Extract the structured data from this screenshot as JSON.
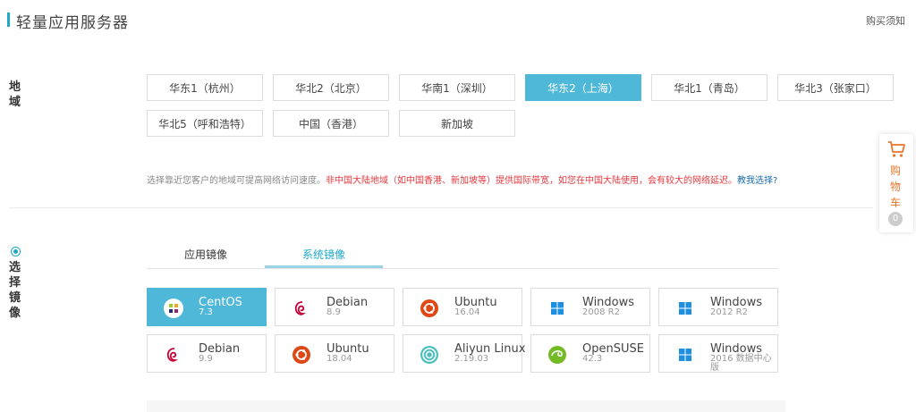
{
  "header": {
    "title": "轻量应用服务器",
    "notice": "购买须知"
  },
  "region": {
    "label": "地域",
    "items": [
      {
        "label": "华东1（杭州）",
        "active": false
      },
      {
        "label": "华北2（北京）",
        "active": false
      },
      {
        "label": "华南1（深圳）",
        "active": false
      },
      {
        "label": "华东2（上海）",
        "active": true
      },
      {
        "label": "华北1（青岛）",
        "active": false
      },
      {
        "label": "华北3（张家口）",
        "active": false
      },
      {
        "label": "华北5（呼和浩特）",
        "active": false
      },
      {
        "label": "中国（香港）",
        "active": false
      },
      {
        "label": "新加坡",
        "active": false
      }
    ],
    "hint_plain": "选择靠近您客户的地域可提高网络访问速度。",
    "hint_warning": "非中国大陆地域（如中国香港、新加坡等）提供国际带宽，如您在中国大陆使用，会有较大的网络延迟。",
    "hint_link": "教我选择?"
  },
  "image": {
    "label": "选择镜像",
    "tabs": [
      {
        "label": "应用镜像",
        "active": false
      },
      {
        "label": "系统镜像",
        "active": true
      }
    ],
    "os_list": [
      {
        "name": "CentOS",
        "version": "7.3",
        "icon": "centos-icon",
        "active": true
      },
      {
        "name": "Debian",
        "version": "8.9",
        "icon": "debian-icon",
        "active": false
      },
      {
        "name": "Ubuntu",
        "version": "16.04",
        "icon": "ubuntu-icon",
        "active": false
      },
      {
        "name": "Windows",
        "version": "2008 R2",
        "icon": "windows-icon",
        "active": false
      },
      {
        "name": "Windows",
        "version": "2012 R2",
        "icon": "windows-icon",
        "active": false
      },
      {
        "name": "Debian",
        "version": "9.9",
        "icon": "debian-icon",
        "active": false
      },
      {
        "name": "Ubuntu",
        "version": "18.04",
        "icon": "ubuntu-icon",
        "active": false
      },
      {
        "name": "Aliyun Linux",
        "version": "2.19.03",
        "icon": "aliyun-icon",
        "active": false
      },
      {
        "name": "OpenSUSE",
        "version": "42.3",
        "icon": "opensuse-icon",
        "active": false
      },
      {
        "name": "Windows",
        "version": "2016 数据中心版",
        "icon": "windows-icon",
        "active": false
      }
    ]
  },
  "cart": {
    "label": "购物车",
    "count": "0"
  },
  "colors": {
    "accent": "#4fb8d8",
    "warning": "#e2373e",
    "link": "#1a6ca8",
    "cart": "#e8762c"
  }
}
